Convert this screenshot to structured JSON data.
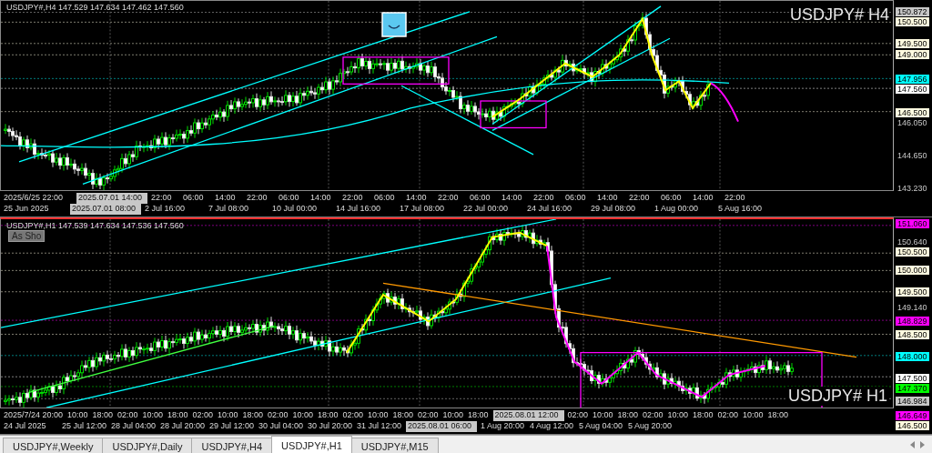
{
  "charts": [
    {
      "header": "USDJPY#,H4  147.529 147.634 147.462 147.560",
      "symbol_label": "USDJPY# H4",
      "has_indicator": true,
      "price_labels": [
        {
          "text": "150.872",
          "kind": "box",
          "color": "#c8c8c8"
        },
        {
          "text": "150.500",
          "kind": "box",
          "color": "#fffbe0"
        },
        {
          "text": "149.500",
          "kind": "box",
          "color": "#fffbe0"
        },
        {
          "text": "149.000",
          "kind": "box",
          "color": "#fffbe0"
        },
        {
          "text": "147.956",
          "kind": "box",
          "color": "#00ffff"
        },
        {
          "text": "147.560",
          "kind": "box",
          "color": "#ffffff"
        },
        {
          "text": "146.500",
          "kind": "box",
          "color": "#fffbe0"
        },
        {
          "text": "146.050",
          "kind": "plain"
        },
        {
          "text": "144.650",
          "kind": "plain"
        },
        {
          "text": "143.230",
          "kind": "plain"
        }
      ],
      "time_axis": {
        "row_1": [
          {
            "text": "2025/6/25 22:00",
            "kind": "plain"
          },
          {
            "text": "2025.07.01 14:00",
            "kind": "box"
          },
          {
            "text": "22:00",
            "kind": "plain"
          },
          {
            "text": "06:00",
            "kind": "plain"
          },
          {
            "text": "14:00",
            "kind": "plain"
          },
          {
            "text": "22:00",
            "kind": "plain"
          },
          {
            "text": "06:00",
            "kind": "plain"
          },
          {
            "text": "14:00",
            "kind": "plain"
          },
          {
            "text": "22:00",
            "kind": "plain"
          },
          {
            "text": "06:00",
            "kind": "plain"
          },
          {
            "text": "14:00",
            "kind": "plain"
          },
          {
            "text": "22:00",
            "kind": "plain"
          },
          {
            "text": "06:00",
            "kind": "plain"
          },
          {
            "text": "14:00",
            "kind": "plain"
          },
          {
            "text": "22:00",
            "kind": "plain"
          },
          {
            "text": "06:00",
            "kind": "plain"
          },
          {
            "text": "14:00",
            "kind": "plain"
          },
          {
            "text": "22:00",
            "kind": "plain"
          },
          {
            "text": "06:00",
            "kind": "plain"
          },
          {
            "text": "14:00",
            "kind": "plain"
          },
          {
            "text": "22:00",
            "kind": "plain"
          }
        ],
        "row_2": [
          {
            "text": "25 Jun 2025",
            "kind": "plain"
          },
          {
            "text": "2025.07.01 08:00",
            "kind": "box"
          },
          {
            "text": "2 Jul 16:00",
            "kind": "plain"
          },
          {
            "text": "7 Jul 08:00",
            "kind": "plain"
          },
          {
            "text": "10 Jul 00:00",
            "kind": "plain"
          },
          {
            "text": "14 Jul 16:00",
            "kind": "plain"
          },
          {
            "text": "17 Jul 08:00",
            "kind": "plain"
          },
          {
            "text": "22 Jul 00:00",
            "kind": "plain"
          },
          {
            "text": "24 Jul 16:00",
            "kind": "plain"
          },
          {
            "text": "29 Jul 08:00",
            "kind": "plain"
          },
          {
            "text": "1 Aug 00:00",
            "kind": "plain"
          },
          {
            "text": "5 Aug 16:00",
            "kind": "plain"
          }
        ]
      }
    },
    {
      "header": "USDJPY#,H1  147.539 147.634 147.536 147.560",
      "symbol_label": "USDJPY# H1",
      "button": "As Sho",
      "price_labels": [
        {
          "text": "151.060",
          "kind": "box",
          "color": "#ff00ff"
        },
        {
          "text": "150.640",
          "kind": "plain"
        },
        {
          "text": "150.500",
          "kind": "box",
          "color": "#fffbe0"
        },
        {
          "text": "150.000",
          "kind": "box",
          "color": "#fffbe0"
        },
        {
          "text": "149.500",
          "kind": "box",
          "color": "#fffbe0"
        },
        {
          "text": "149.140",
          "kind": "plain"
        },
        {
          "text": "148.829",
          "kind": "box",
          "color": "#ff00ff"
        },
        {
          "text": "148.500",
          "kind": "box",
          "color": "#fffbe0"
        },
        {
          "text": "148.000",
          "kind": "box",
          "color": "#00ffff"
        },
        {
          "text": "147.500",
          "kind": "box",
          "color": "#ffffff"
        },
        {
          "text": "147.370",
          "kind": "box",
          "color": "#00ff00"
        },
        {
          "text": "146.984",
          "kind": "box",
          "color": "#c8c8c8"
        },
        {
          "text": "146.649",
          "kind": "box",
          "color": "#ff00ff"
        },
        {
          "text": "146.500",
          "kind": "box",
          "color": "#fffbe0"
        }
      ],
      "time_axis": {
        "row_1": [
          {
            "text": "2025/7/24 20:00",
            "kind": "plain"
          },
          {
            "text": "10:00",
            "kind": "plain"
          },
          {
            "text": "18:00",
            "kind": "plain"
          },
          {
            "text": "02:00",
            "kind": "plain"
          },
          {
            "text": "10:00",
            "kind": "plain"
          },
          {
            "text": "18:00",
            "kind": "plain"
          },
          {
            "text": "02:00",
            "kind": "plain"
          },
          {
            "text": "10:00",
            "kind": "plain"
          },
          {
            "text": "18:00",
            "kind": "plain"
          },
          {
            "text": "02:00",
            "kind": "plain"
          },
          {
            "text": "10:00",
            "kind": "plain"
          },
          {
            "text": "18:00",
            "kind": "plain"
          },
          {
            "text": "02:00",
            "kind": "plain"
          },
          {
            "text": "10:00",
            "kind": "plain"
          },
          {
            "text": "18:00",
            "kind": "plain"
          },
          {
            "text": "02:00",
            "kind": "plain"
          },
          {
            "text": "10:00",
            "kind": "plain"
          },
          {
            "text": "18:00",
            "kind": "plain"
          },
          {
            "text": "2025.08.01 12:00",
            "kind": "box"
          },
          {
            "text": "02:00",
            "kind": "plain"
          },
          {
            "text": "10:00",
            "kind": "plain"
          },
          {
            "text": "18:00",
            "kind": "plain"
          },
          {
            "text": "02:00",
            "kind": "plain"
          },
          {
            "text": "10:00",
            "kind": "plain"
          },
          {
            "text": "18:00",
            "kind": "plain"
          },
          {
            "text": "02:00",
            "kind": "plain"
          },
          {
            "text": "10:00",
            "kind": "plain"
          },
          {
            "text": "18:00",
            "kind": "plain"
          }
        ],
        "row_2": [
          {
            "text": "24 Jul 2025",
            "kind": "plain"
          },
          {
            "text": "25 Jul 12:00",
            "kind": "plain"
          },
          {
            "text": "28 Jul 04:00",
            "kind": "plain"
          },
          {
            "text": "28 Jul 20:00",
            "kind": "plain"
          },
          {
            "text": "29 Jul 12:00",
            "kind": "plain"
          },
          {
            "text": "30 Jul 04:00",
            "kind": "plain"
          },
          {
            "text": "30 Jul 20:00",
            "kind": "plain"
          },
          {
            "text": "31 Jul 12:00",
            "kind": "plain"
          },
          {
            "text": "2025.08.01 06:00",
            "kind": "box"
          },
          {
            "text": "1 Aug 20:00",
            "kind": "plain"
          },
          {
            "text": "4 Aug 12:00",
            "kind": "plain"
          },
          {
            "text": "5 Aug 04:00",
            "kind": "plain"
          },
          {
            "text": "5 Aug 20:00",
            "kind": "plain"
          }
        ]
      }
    }
  ],
  "tabs": [
    {
      "label": "USDJPY#,Weekly",
      "selected": false
    },
    {
      "label": "USDJPY#,Daily",
      "selected": false
    },
    {
      "label": "USDJPY#,H4",
      "selected": false
    },
    {
      "label": "USDJPY#,H1",
      "selected": true
    },
    {
      "label": "USDJPY#,M15",
      "selected": false
    }
  ]
}
